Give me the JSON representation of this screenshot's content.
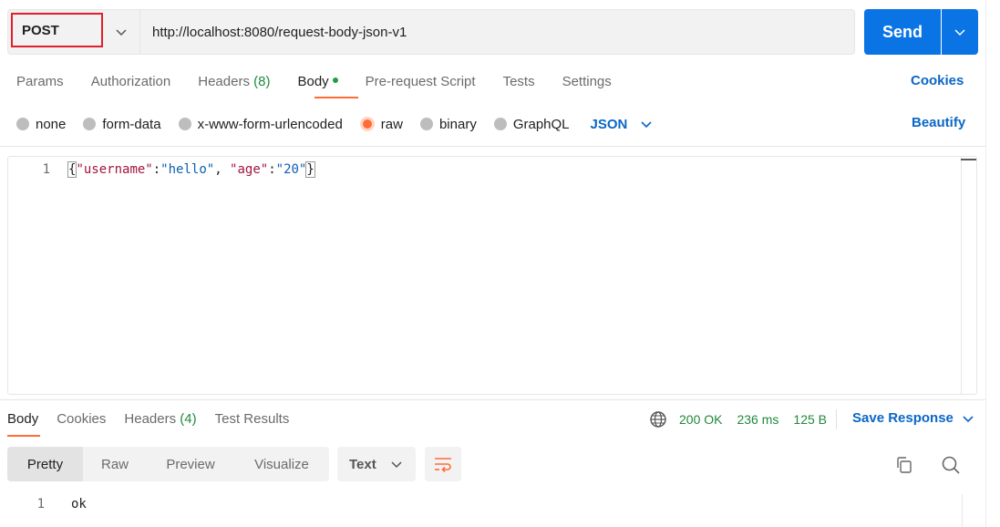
{
  "request": {
    "method": "POST",
    "url": "http://localhost:8080/request-body-json-v1",
    "send_label": "Send"
  },
  "request_tabs": {
    "params": "Params",
    "authorization": "Authorization",
    "headers": "Headers",
    "headers_count": "(8)",
    "body": "Body",
    "pre_request": "Pre-request Script",
    "tests": "Tests",
    "settings": "Settings",
    "cookies": "Cookies"
  },
  "body_types": {
    "none": "none",
    "form_data": "form-data",
    "urlencoded": "x-www-form-urlencoded",
    "raw": "raw",
    "binary": "binary",
    "graphql": "GraphQL",
    "selected": "raw",
    "language": "JSON",
    "beautify": "Beautify"
  },
  "editor": {
    "line_number": "1",
    "tokens": {
      "open": "{",
      "key1": "\"username\"",
      "colon1": ":",
      "val1": "\"hello\"",
      "comma": ", ",
      "key2": "\"age\"",
      "colon2": ":",
      "val2": "\"20\"",
      "close": "}"
    }
  },
  "response": {
    "tabs": {
      "body": "Body",
      "cookies": "Cookies",
      "headers": "Headers",
      "headers_count": "(4)",
      "test_results": "Test Results"
    },
    "status": "200 OK",
    "time": "236 ms",
    "size": "125 B",
    "save_label": "Save Response",
    "views": {
      "pretty": "Pretty",
      "raw": "Raw",
      "preview": "Preview",
      "visualize": "Visualize"
    },
    "format": "Text",
    "line_number": "1",
    "content": "ok"
  },
  "colors": {
    "accent_blue": "#0b74e5",
    "link_blue": "#0b66c7",
    "active_orange": "#ff6c37",
    "status_green": "#1f8a3b",
    "highlight_red": "#e0202a"
  },
  "icons": {
    "method_dropdown": "chevron-down-icon",
    "send_dropdown": "chevron-down-icon",
    "globe": "globe-icon",
    "wrap": "wrap-lines-icon",
    "copy": "copy-icon",
    "search": "search-icon"
  }
}
